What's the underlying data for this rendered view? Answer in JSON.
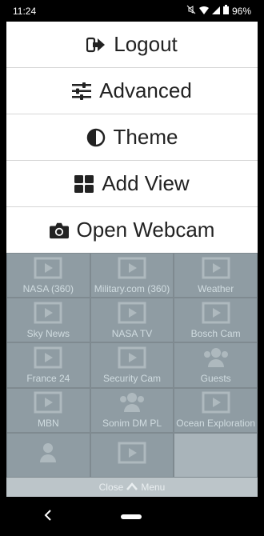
{
  "status": {
    "time": "11:24",
    "battery": "96%"
  },
  "menu": {
    "items": [
      {
        "label": "Logout",
        "icon": "logout-icon"
      },
      {
        "label": "Advanced",
        "icon": "sliders-icon"
      },
      {
        "label": "Theme",
        "icon": "theme-contrast-icon"
      },
      {
        "label": "Add View",
        "icon": "grid-view-icon"
      },
      {
        "label": "Open Webcam",
        "icon": "camera-icon"
      }
    ]
  },
  "grid": {
    "tiles": [
      {
        "label": "NASA (360)",
        "icon": "video-icon"
      },
      {
        "label": "Military.com (360)",
        "icon": "video-icon"
      },
      {
        "label": "Weather",
        "icon": "video-icon"
      },
      {
        "label": "Sky News",
        "icon": "video-icon"
      },
      {
        "label": "NASA TV",
        "icon": "video-icon"
      },
      {
        "label": "Bosch Cam",
        "icon": "video-icon"
      },
      {
        "label": "France 24",
        "icon": "video-icon"
      },
      {
        "label": "Security Cam",
        "icon": "video-icon"
      },
      {
        "label": "Guests",
        "icon": "users-icon"
      },
      {
        "label": "MBN",
        "icon": "video-icon"
      },
      {
        "label": "Sonim DM PL",
        "icon": "users-icon"
      },
      {
        "label": "Ocean Exploration",
        "icon": "video-icon"
      },
      {
        "label": "",
        "icon": "users-icon"
      },
      {
        "label": "",
        "icon": "video-icon"
      },
      {
        "label": "",
        "icon": "video-icon"
      }
    ]
  },
  "close_menu": {
    "label_before": "Close",
    "label_after": "Menu"
  },
  "colors": {
    "menu_bg": "#ffffff",
    "overlay": "#9aa6ad",
    "text": "#222222"
  }
}
